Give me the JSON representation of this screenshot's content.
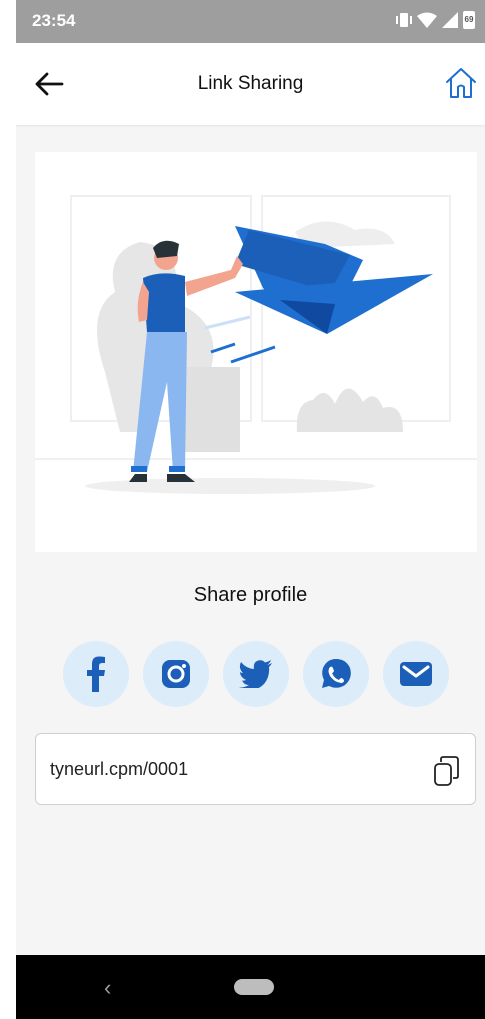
{
  "status_bar": {
    "time": "23:54",
    "battery": "69"
  },
  "app_bar": {
    "title": "Link Sharing"
  },
  "share": {
    "label": "Share profile"
  },
  "socials": [
    {
      "name": "facebook"
    },
    {
      "name": "instagram"
    },
    {
      "name": "twitter"
    },
    {
      "name": "whatsapp"
    },
    {
      "name": "email"
    }
  ],
  "link": {
    "url": "tyneurl.cpm/0001"
  },
  "colors": {
    "accent": "#1e6fd0",
    "icon_bg": "#dcecf9",
    "status_bar": "#9e9e9e"
  }
}
